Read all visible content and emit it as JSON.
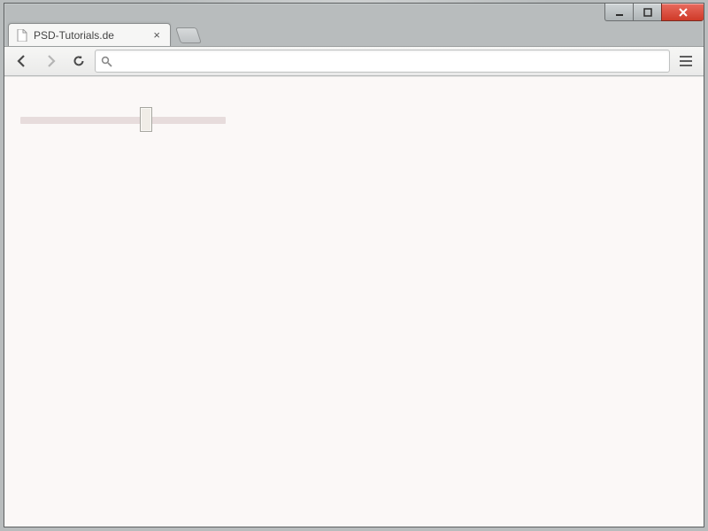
{
  "window": {
    "minimize_icon": "minimize-icon",
    "maximize_icon": "maximize-icon",
    "close_icon": "close-icon"
  },
  "tab": {
    "title": "PSD-Tutorials.de",
    "close_glyph": "×"
  },
  "toolbar": {
    "back_icon": "back-icon",
    "forward_icon": "forward-icon",
    "reload_icon": "reload-icon",
    "search_icon": "search-icon",
    "url_value": "",
    "menu_icon": "hamburger-icon"
  },
  "page": {
    "slider": {
      "min": 0,
      "max": 100,
      "value": 62
    }
  }
}
